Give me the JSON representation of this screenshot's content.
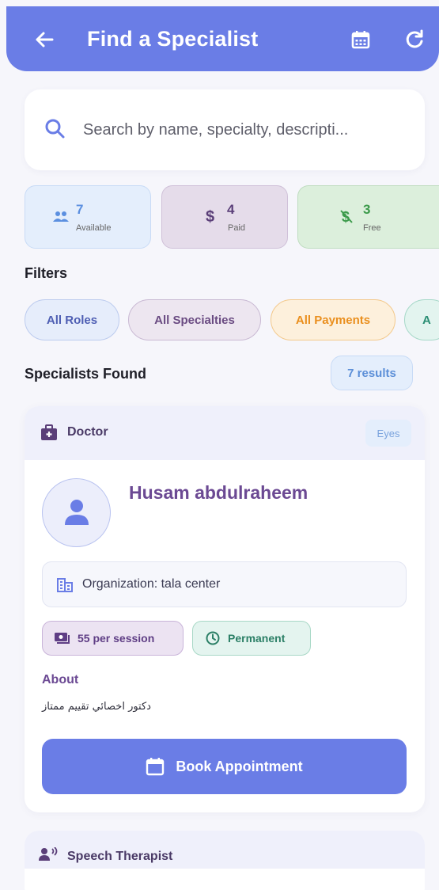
{
  "app_bar": {
    "title": "Find a Specialist",
    "back_icon": "arrow-left-icon",
    "calendar_icon": "calendar-icon",
    "refresh_icon": "refresh-icon",
    "color": "#6a7de6"
  },
  "search": {
    "placeholder": "Search by name, specialty, descripti...",
    "icon": "search-icon"
  },
  "stats": [
    {
      "value": "7",
      "label": "Available",
      "icon": "people-icon",
      "color": "#5b8fe0"
    },
    {
      "value": "4",
      "label": "Paid",
      "icon": "dollar-icon",
      "color": "#5a3e78"
    },
    {
      "value": "3",
      "label": "Free",
      "icon": "money-off-icon",
      "color": "#3b9a4a"
    }
  ],
  "filters": {
    "heading": "Filters",
    "chips": [
      "All Roles",
      "All Specialties",
      "All Payments",
      "A"
    ]
  },
  "results": {
    "heading": "Specialists Found",
    "count_label": "7 results"
  },
  "specialists": [
    {
      "role": "Doctor",
      "role_icon": "medical-bag-icon",
      "tag": "Eyes",
      "name": "Husam abdulraheem",
      "avatar_icon": "person-icon",
      "organization": "Organization: tala center",
      "price": "55 per session",
      "type": "Permanent",
      "about_heading": "About",
      "about": "دكتور اخصائي تقييم ممتاز",
      "book_label": "Book Appointment"
    },
    {
      "role": "Speech Therapist",
      "role_icon": "speaking-person-icon"
    }
  ]
}
